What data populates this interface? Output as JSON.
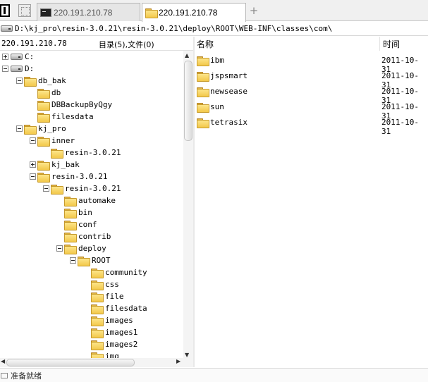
{
  "tabs": [
    {
      "label": "220.191.210.78",
      "active": false,
      "icon": "terminal-icon"
    },
    {
      "label": "220.191.210.78",
      "active": true,
      "icon": "folder-icon"
    }
  ],
  "address": {
    "path": "D:\\kj_pro\\resin-3.0.21\\resin-3.0.21\\deploy\\ROOT\\WEB-INF\\classes\\com\\"
  },
  "left_panel": {
    "host": "220.191.210.78",
    "counts": "目录(5),文件(0)"
  },
  "tree": [
    {
      "label": "C:",
      "depth": 0,
      "kind": "drive",
      "toggle": "plus"
    },
    {
      "label": "D:",
      "depth": 0,
      "kind": "drive",
      "toggle": "minus"
    },
    {
      "label": "db_bak",
      "depth": 1,
      "kind": "folder",
      "toggle": "minus"
    },
    {
      "label": "db",
      "depth": 2,
      "kind": "folder",
      "toggle": "none"
    },
    {
      "label": "DBBackupByQgy",
      "depth": 2,
      "kind": "folder",
      "toggle": "none"
    },
    {
      "label": "filesdata",
      "depth": 2,
      "kind": "folder",
      "toggle": "none"
    },
    {
      "label": "kj_pro",
      "depth": 1,
      "kind": "folder",
      "toggle": "minus"
    },
    {
      "label": "inner",
      "depth": 2,
      "kind": "folder",
      "toggle": "minus"
    },
    {
      "label": "resin-3.0.21",
      "depth": 3,
      "kind": "folder",
      "toggle": "none"
    },
    {
      "label": "kj_bak",
      "depth": 2,
      "kind": "folder",
      "toggle": "plus"
    },
    {
      "label": "resin-3.0.21",
      "depth": 2,
      "kind": "folder",
      "toggle": "minus"
    },
    {
      "label": "resin-3.0.21",
      "depth": 3,
      "kind": "folder",
      "toggle": "minus"
    },
    {
      "label": "automake",
      "depth": 4,
      "kind": "folder",
      "toggle": "none"
    },
    {
      "label": "bin",
      "depth": 4,
      "kind": "folder",
      "toggle": "none"
    },
    {
      "label": "conf",
      "depth": 4,
      "kind": "folder",
      "toggle": "none"
    },
    {
      "label": "contrib",
      "depth": 4,
      "kind": "folder",
      "toggle": "none"
    },
    {
      "label": "deploy",
      "depth": 4,
      "kind": "folder",
      "toggle": "minus"
    },
    {
      "label": "ROOT",
      "depth": 5,
      "kind": "folder",
      "toggle": "minus"
    },
    {
      "label": "community",
      "depth": 6,
      "kind": "folder",
      "toggle": "none"
    },
    {
      "label": "css",
      "depth": 6,
      "kind": "folder",
      "toggle": "none"
    },
    {
      "label": "file",
      "depth": 6,
      "kind": "folder",
      "toggle": "none"
    },
    {
      "label": "filesdata",
      "depth": 6,
      "kind": "folder",
      "toggle": "none"
    },
    {
      "label": "images",
      "depth": 6,
      "kind": "folder",
      "toggle": "none"
    },
    {
      "label": "images1",
      "depth": 6,
      "kind": "folder",
      "toggle": "none"
    },
    {
      "label": "images2",
      "depth": 6,
      "kind": "folder",
      "toggle": "none"
    },
    {
      "label": "img",
      "depth": 6,
      "kind": "folder",
      "toggle": "none"
    }
  ],
  "list": {
    "columns": {
      "name": "名称",
      "time": "时间"
    },
    "rows": [
      {
        "name": "ibm",
        "date": "2011-10-31"
      },
      {
        "name": "jspsmart",
        "date": "2011-10-31"
      },
      {
        "name": "newsease",
        "date": "2011-10-31"
      },
      {
        "name": "sun",
        "date": "2011-10-31"
      },
      {
        "name": "tetrasix",
        "date": "2011-10-31"
      }
    ]
  },
  "status": {
    "text": "准备就绪"
  }
}
